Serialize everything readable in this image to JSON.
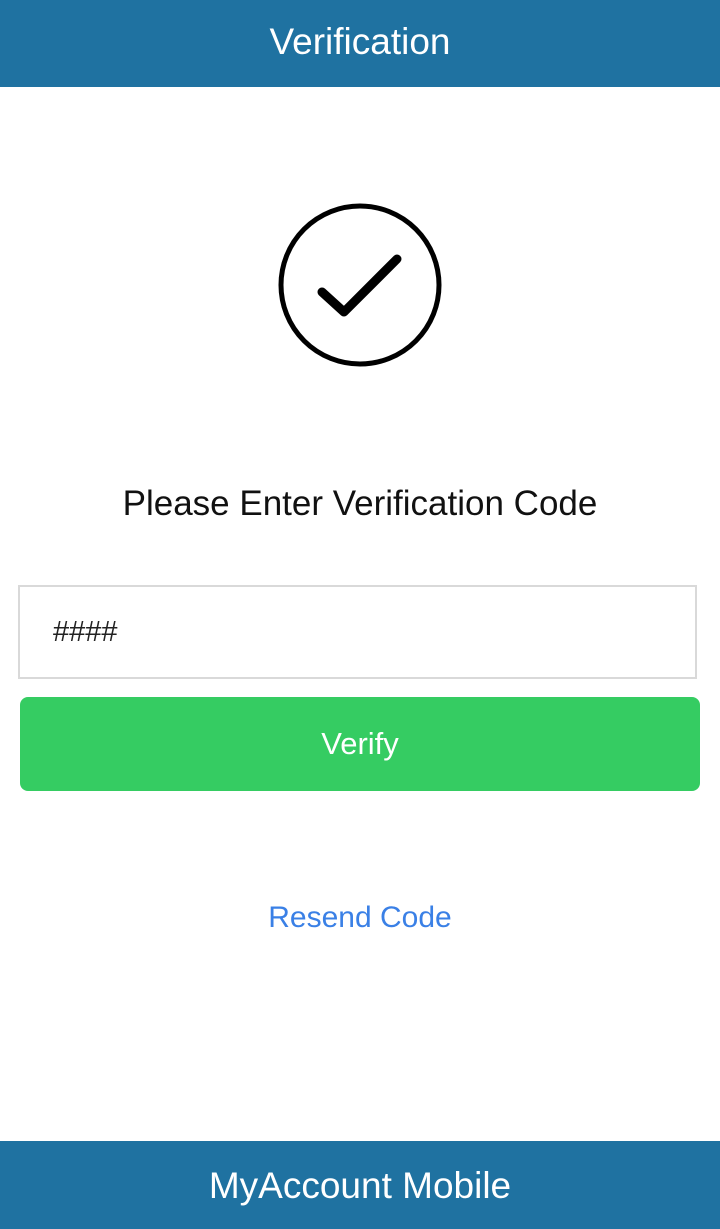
{
  "header": {
    "title": "Verification"
  },
  "main": {
    "icon": "checkmark-circle-icon",
    "prompt": "Please Enter Verification Code",
    "code_input": {
      "value": "",
      "placeholder": "####"
    },
    "verify_label": "Verify",
    "resend_label": "Resend Code"
  },
  "footer": {
    "title": "MyAccount Mobile"
  },
  "colors": {
    "header_bg": "#1f72a1",
    "button_green": "#35cc62",
    "link_blue": "#3a80e6"
  }
}
